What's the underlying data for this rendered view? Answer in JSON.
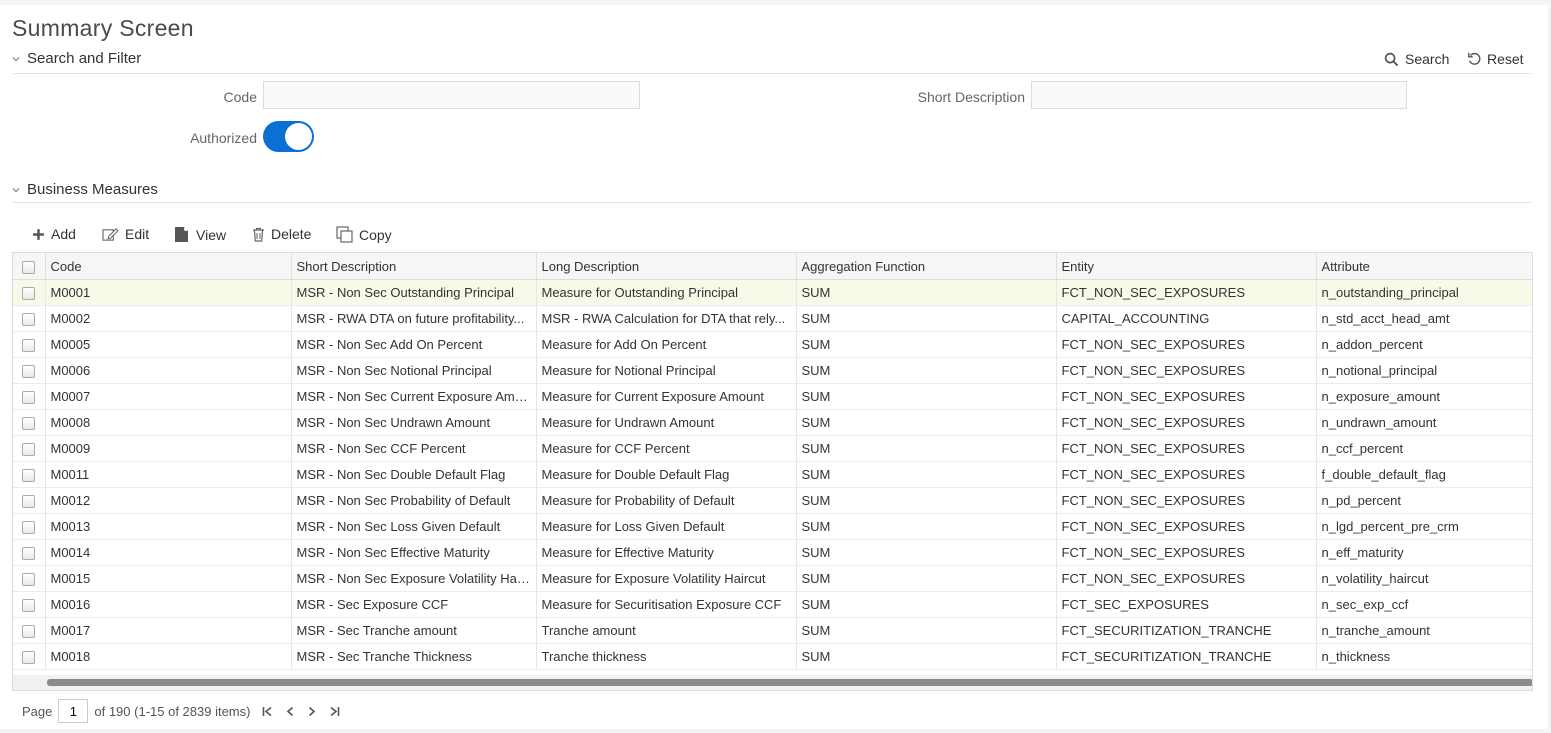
{
  "page": {
    "title": "Summary Screen"
  },
  "search_filter": {
    "header": "Search and Filter",
    "search_label": "Search",
    "reset_label": "Reset",
    "code_label": "Code",
    "code_value": "",
    "short_desc_label": "Short Description",
    "short_desc_value": "",
    "authorized_label": "Authorized",
    "authorized_on": true
  },
  "business_measures": {
    "header": "Business Measures",
    "toolbar": {
      "add": "Add",
      "edit": "Edit",
      "view": "View",
      "delete": "Delete",
      "copy": "Copy"
    },
    "columns": [
      "Code",
      "Short Description",
      "Long Description",
      "Aggregation Function",
      "Entity",
      "Attribute"
    ],
    "rows": [
      [
        "M0001",
        "MSR - Non Sec Outstanding Principal",
        "Measure for Outstanding Principal",
        "SUM",
        "FCT_NON_SEC_EXPOSURES",
        "n_outstanding_principal"
      ],
      [
        "M0002",
        "MSR - RWA DTA on future profitability...",
        "MSR - RWA Calculation for DTA that rely...",
        "SUM",
        "CAPITAL_ACCOUNTING",
        "n_std_acct_head_amt"
      ],
      [
        "M0005",
        "MSR - Non Sec Add On Percent",
        "Measure for Add On Percent",
        "SUM",
        "FCT_NON_SEC_EXPOSURES",
        "n_addon_percent"
      ],
      [
        "M0006",
        "MSR - Non Sec Notional Principal",
        "Measure for Notional Principal",
        "SUM",
        "FCT_NON_SEC_EXPOSURES",
        "n_notional_principal"
      ],
      [
        "M0007",
        "MSR - Non Sec Current Exposure Amo...",
        "Measure for Current Exposure Amount",
        "SUM",
        "FCT_NON_SEC_EXPOSURES",
        "n_exposure_amount"
      ],
      [
        "M0008",
        "MSR - Non Sec Undrawn Amount",
        "Measure for Undrawn Amount",
        "SUM",
        "FCT_NON_SEC_EXPOSURES",
        "n_undrawn_amount"
      ],
      [
        "M0009",
        "MSR - Non Sec CCF Percent",
        "Measure for CCF Percent",
        "SUM",
        "FCT_NON_SEC_EXPOSURES",
        "n_ccf_percent"
      ],
      [
        "M0011",
        "MSR - Non Sec Double Default Flag",
        "Measure for Double Default Flag",
        "SUM",
        "FCT_NON_SEC_EXPOSURES",
        "f_double_default_flag"
      ],
      [
        "M0012",
        "MSR - Non Sec Probability of Default",
        "Measure for Probability of Default",
        "SUM",
        "FCT_NON_SEC_EXPOSURES",
        "n_pd_percent"
      ],
      [
        "M0013",
        "MSR - Non Sec Loss Given Default",
        "Measure for Loss Given Default",
        "SUM",
        "FCT_NON_SEC_EXPOSURES",
        "n_lgd_percent_pre_crm"
      ],
      [
        "M0014",
        "MSR - Non Sec Effective Maturity",
        "Measure for Effective Maturity",
        "SUM",
        "FCT_NON_SEC_EXPOSURES",
        "n_eff_maturity"
      ],
      [
        "M0015",
        "MSR - Non Sec Exposure Volatility Hai...",
        "Measure for Exposure Volatility Haircut",
        "SUM",
        "FCT_NON_SEC_EXPOSURES",
        "n_volatility_haircut"
      ],
      [
        "M0016",
        "MSR - Sec Exposure CCF",
        "Measure for Securitisation Exposure CCF",
        "SUM",
        "FCT_SEC_EXPOSURES",
        "n_sec_exp_ccf"
      ],
      [
        "M0017",
        "MSR - Sec Tranche amount",
        "Tranche amount",
        "SUM",
        "FCT_SECURITIZATION_TRANCHE",
        "n_tranche_amount"
      ],
      [
        "M0018",
        "MSR - Sec Tranche Thickness",
        "Tranche thickness",
        "SUM",
        "FCT_SECURITIZATION_TRANCHE",
        "n_thickness"
      ]
    ],
    "selected_row": 0
  },
  "pager": {
    "page_label": "Page",
    "page_value": "1",
    "info": "of 190 (1-15 of 2839 items)"
  },
  "colors": {
    "accent": "#0a70d4",
    "selected_row": "#f7f9e9"
  }
}
